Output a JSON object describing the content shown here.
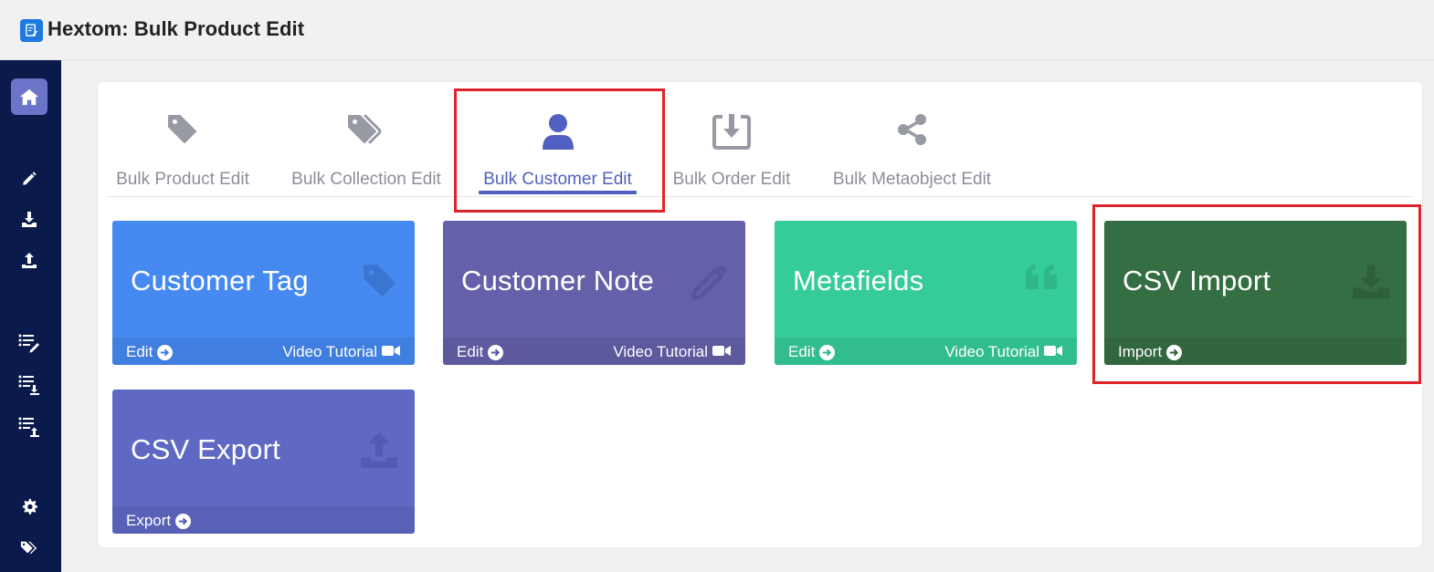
{
  "app": {
    "title": "Hextom: Bulk Product Edit"
  },
  "sidebar": {
    "items": [
      {
        "name": "home-icon"
      },
      {
        "name": "pencil-icon"
      },
      {
        "name": "download-icon"
      },
      {
        "name": "upload-icon"
      },
      {
        "name": "list-edit-icon"
      },
      {
        "name": "list-download-icon"
      },
      {
        "name": "list-upload-icon"
      },
      {
        "name": "gear-icon"
      },
      {
        "name": "tags-icon"
      }
    ]
  },
  "tabs": [
    {
      "label": "Bulk Product Edit",
      "icon": "tag-icon"
    },
    {
      "label": "Bulk Collection Edit",
      "icon": "tags-icon"
    },
    {
      "label": "Bulk Customer Edit",
      "icon": "user-icon",
      "active": true
    },
    {
      "label": "Bulk Order Edit",
      "icon": "download-box-icon"
    },
    {
      "label": "Bulk Metaobject Edit",
      "icon": "share-icon"
    }
  ],
  "tiles": [
    {
      "title": "Customer Tag",
      "left_action": "Edit",
      "right_action": "Video Tutorial",
      "color": "#4589f1",
      "icon": "tag-icon"
    },
    {
      "title": "Customer Note",
      "left_action": "Edit",
      "right_action": "Video Tutorial",
      "color": "#6460a9",
      "icon": "pencil-icon"
    },
    {
      "title": "Metafields",
      "left_action": "Edit",
      "right_action": "Video Tutorial",
      "color": "#36cc98",
      "icon": "quote-icon"
    },
    {
      "title": "CSV Import",
      "left_action": "Import",
      "color": "#356e43",
      "icon": "download-icon"
    },
    {
      "title": "CSV Export",
      "left_action": "Export",
      "color": "#5f69c4",
      "icon": "upload-icon"
    }
  ],
  "colors": {
    "sidebar": "#0a1a4a",
    "accent": "#5160c0",
    "highlight": "#e0232a"
  }
}
